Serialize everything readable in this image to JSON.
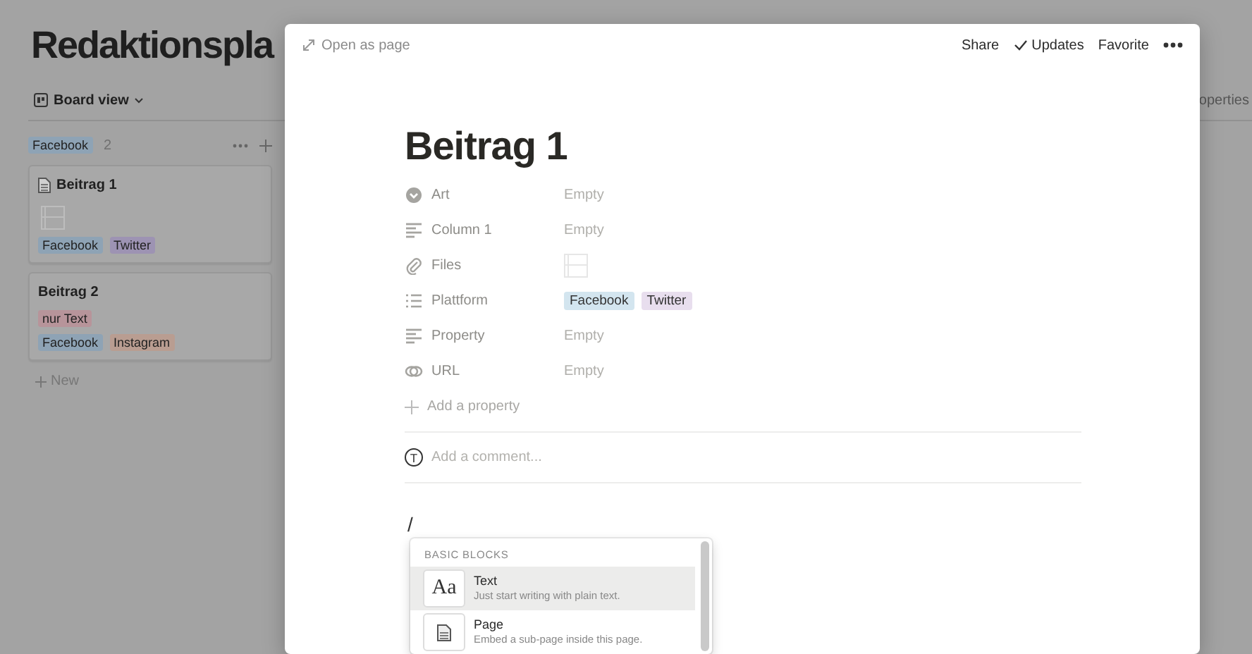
{
  "board": {
    "title": "Redaktionspla",
    "view": "Board view",
    "properties_fragment": "operties",
    "group": {
      "label": "Facebook",
      "color": "#8ea3b5",
      "count": "2"
    },
    "cards": [
      {
        "title": "Beitrag 1",
        "page_icon": true,
        "file_preview": true,
        "tag_rows": [
          [
            {
              "label": "Facebook",
              "color": "#8ea3b5"
            },
            {
              "label": "Twitter",
              "color": "#9d93b3"
            }
          ]
        ]
      },
      {
        "title": "Beitrag 2",
        "page_icon": false,
        "file_preview": false,
        "tag_rows": [
          [
            {
              "label": "nur Text",
              "color": "#b7949a"
            }
          ],
          [
            {
              "label": "Facebook",
              "color": "#8ea3b5"
            },
            {
              "label": "Instagram",
              "color": "#b99d91"
            }
          ]
        ]
      }
    ],
    "new_label": "New"
  },
  "modal": {
    "open_as_page": "Open as page",
    "actions": [
      {
        "label": "Share",
        "kind": "plain"
      },
      {
        "label": "Updates",
        "kind": "check"
      },
      {
        "label": "Favorite",
        "kind": "plain"
      }
    ],
    "title": "Beitrag 1",
    "properties": [
      {
        "label": "Art",
        "kind": "select",
        "value": "Empty"
      },
      {
        "label": "Column 1",
        "kind": "text",
        "value": "Empty"
      },
      {
        "label": "Files",
        "kind": "files"
      },
      {
        "label": "Plattform",
        "kind": "multi_select",
        "tags": [
          {
            "label": "Facebook",
            "color": "#d3e5ef"
          },
          {
            "label": "Twitter",
            "color": "#e8deee"
          }
        ]
      },
      {
        "label": "Property",
        "kind": "text",
        "value": "Empty"
      },
      {
        "label": "URL",
        "kind": "url",
        "value": "Empty"
      }
    ],
    "add_property": "Add a property",
    "comment": {
      "avatar_initial": "T",
      "placeholder": "Add a comment..."
    },
    "typed": "/",
    "menu": {
      "header": "BASIC BLOCKS",
      "items": [
        {
          "title": "Text",
          "description": "Just start writing with plain text.",
          "kind": "text",
          "icon_label": "Aa",
          "selected": true
        },
        {
          "title": "Page",
          "description": "Embed a sub-page inside this page.",
          "kind": "page",
          "selected": false
        }
      ]
    }
  }
}
